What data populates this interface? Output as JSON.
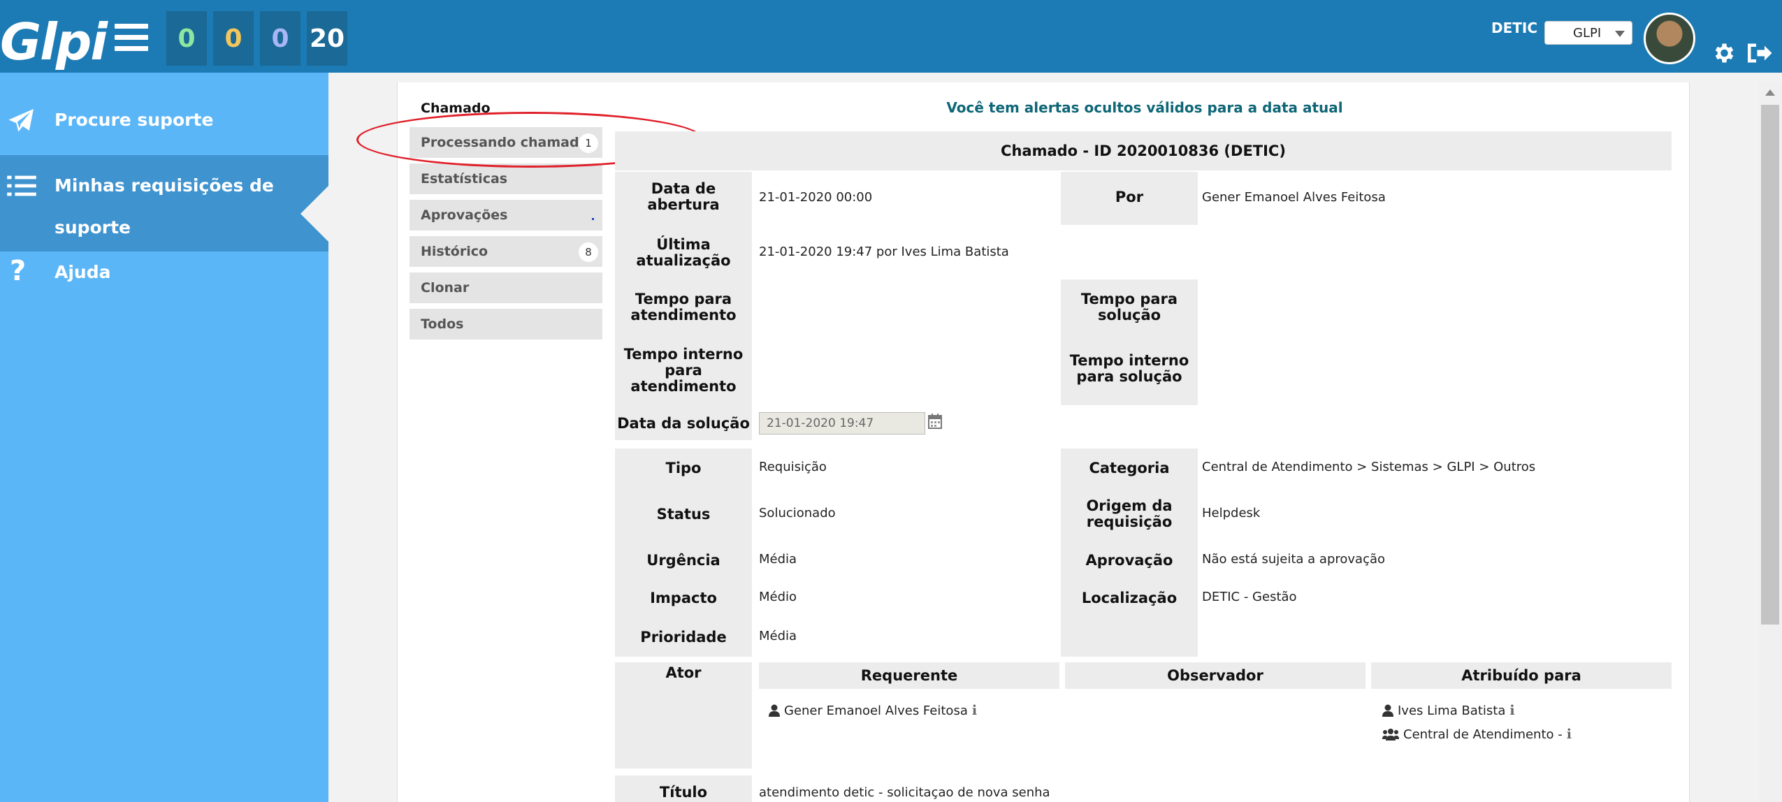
{
  "header": {
    "logo_text": "Glpi",
    "counters": [
      {
        "value": "0",
        "color": "#8ee6a0"
      },
      {
        "value": "0",
        "color": "#f3c65c"
      },
      {
        "value": "0",
        "color": "#a9b6f5"
      },
      {
        "value": "20",
        "color": "#ffffff"
      }
    ],
    "entity_label": "DETIC",
    "profile_select": "GLPI"
  },
  "sidebar": {
    "items": [
      {
        "label": "Procure suporte",
        "icon": "paper-plane-icon"
      },
      {
        "label_line1": "Minhas requisições de",
        "label_line2": "suporte",
        "icon": "list-icon",
        "active": true
      },
      {
        "label": "Ajuda",
        "icon": "question-icon"
      }
    ]
  },
  "tabs": {
    "title": "Chamado",
    "items": [
      {
        "label": "Processando chamado",
        "badge": "1"
      },
      {
        "label": "Estatísticas"
      },
      {
        "label": "Aprovações"
      },
      {
        "label": "Histórico",
        "badge": "8"
      },
      {
        "label": "Clonar"
      },
      {
        "label": "Todos"
      }
    ]
  },
  "alert": "Você tem alertas ocultos válidos para a data atual",
  "ticket": {
    "title": "Chamado - ID 2020010836 (DETIC)",
    "fields": {
      "opening_date_label": "Data de abertura",
      "opening_date": "21-01-2020 00:00",
      "by_label": "Por",
      "by": "Gener Emanoel Alves Feitosa",
      "last_update_label": "Última atualização",
      "last_update": "21-01-2020 19:47 por Ives Lima Batista",
      "tta_label": "Tempo para atendimento",
      "ttr_label": "Tempo para solução",
      "internal_tta_label": "Tempo interno para atendimento",
      "internal_ttr_label": "Tempo interno para solução",
      "solution_date_label": "Data da solução",
      "solution_date": "21-01-2020 19:47",
      "type_label": "Tipo",
      "type": "Requisição",
      "category_label": "Categoria",
      "category": "Central de Atendimento > Sistemas > GLPI > Outros",
      "status_label": "Status",
      "status": "Solucionado",
      "origin_label": "Origem da requisição",
      "origin": "Helpdesk",
      "urgency_label": "Urgência",
      "urgency": "Média",
      "approval_label": "Aprovação",
      "approval": "Não está sujeita a aprovação",
      "impact_label": "Impacto",
      "impact": "Médio",
      "location_label": "Localização",
      "location": "DETIC - Gestão",
      "priority_label": "Prioridade",
      "priority": "Média",
      "actor_label": "Ator",
      "requester_label": "Requerente",
      "observer_label": "Observador",
      "assigned_label": "Atribuído para",
      "requester": "Gener Emanoel Alves Feitosa",
      "assigned_user": "Ives Lima Batista",
      "assigned_group": "Central de Atendimento -",
      "title_label": "Título",
      "title_value": "atendimento detic - solicitaçao de nova senha"
    }
  }
}
